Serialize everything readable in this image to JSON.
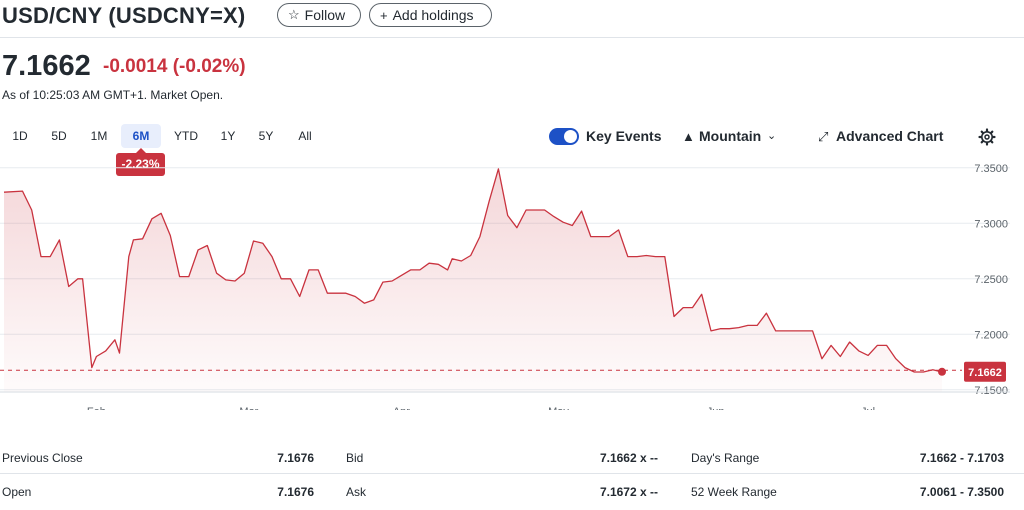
{
  "header": {
    "title": "USD/CNY (USDCNY=X)",
    "follow_label": "Follow",
    "add_holdings_label": "Add holdings"
  },
  "quote": {
    "price": "7.1662",
    "change": "-0.0014",
    "change_pct": "(-0.02%)",
    "as_of": "As of 10:25:03 AM GMT+1. Market Open.",
    "change_color": "#c9333f"
  },
  "ranges": {
    "items": [
      "1D",
      "5D",
      "1M",
      "6M",
      "YTD",
      "1Y",
      "5Y",
      "All"
    ],
    "active": "6M",
    "active_change": "-2.23%"
  },
  "controls": {
    "key_events_label": "Key Events",
    "key_events_on": true,
    "chart_type_label": "Mountain",
    "advanced_chart_label": "Advanced Chart",
    "chart_type_icon": "mountain-icon",
    "advanced_icon": "expand-icon",
    "settings_icon": "gear-icon"
  },
  "chart_data": {
    "type": "area",
    "line_color": "#c9333f",
    "ylim": [
      7.148,
      7.357
    ],
    "yticks": [
      "7.3500",
      "7.3000",
      "7.2500",
      "7.2000",
      "7.1500"
    ],
    "xlabels": [
      {
        "label": "Feb",
        "day": 20
      },
      {
        "label": "Mar",
        "day": 53
      },
      {
        "label": "Apr",
        "day": 86
      },
      {
        "label": "May",
        "day": 120
      },
      {
        "label": "Jun",
        "day": 154
      },
      {
        "label": "Jul",
        "day": 187
      }
    ],
    "previous_close": 7.1676,
    "last_value": 7.1662,
    "last_label": "7.1662",
    "x": [
      0,
      4,
      6,
      8,
      10,
      12,
      14,
      16,
      17,
      19,
      20,
      22,
      24,
      25,
      27,
      28,
      30,
      32,
      34,
      36,
      38,
      40,
      42,
      44,
      46,
      48,
      50,
      52,
      54,
      56,
      58,
      60,
      62,
      64,
      66,
      68,
      70,
      72,
      74,
      76,
      78,
      80,
      82,
      84,
      86,
      88,
      90,
      92,
      94,
      96,
      97,
      99,
      101,
      103,
      105,
      107,
      109,
      111,
      113,
      115,
      117,
      119,
      121,
      123,
      125,
      127,
      129,
      131,
      133,
      135,
      137,
      139,
      141,
      143,
      145,
      147,
      149,
      151,
      153,
      155,
      157,
      159,
      161,
      163,
      165,
      167,
      169,
      171,
      173,
      175,
      177,
      179,
      181,
      183,
      185,
      187,
      189,
      191,
      193,
      195,
      197,
      199,
      201,
      203
    ],
    "y": [
      7.328,
      7.329,
      7.312,
      7.27,
      7.27,
      7.285,
      7.243,
      7.25,
      7.25,
      7.17,
      7.18,
      7.185,
      7.195,
      7.183,
      7.27,
      7.285,
      7.286,
      7.304,
      7.309,
      7.289,
      7.252,
      7.252,
      7.276,
      7.28,
      7.255,
      7.249,
      7.248,
      7.255,
      7.284,
      7.282,
      7.27,
      7.25,
      7.25,
      7.234,
      7.258,
      7.258,
      7.237,
      7.237,
      7.237,
      7.234,
      7.228,
      7.231,
      7.247,
      7.248,
      7.253,
      7.258,
      7.258,
      7.264,
      7.263,
      7.258,
      7.268,
      7.266,
      7.271,
      7.288,
      7.32,
      7.349,
      7.307,
      7.296,
      7.312,
      7.312,
      7.312,
      7.306,
      7.301,
      7.298,
      7.311,
      7.288,
      7.288,
      7.288,
      7.294,
      7.27,
      7.27,
      7.271,
      7.27,
      7.27,
      7.216,
      7.224,
      7.224,
      7.236,
      7.203,
      7.205,
      7.205,
      7.206,
      7.208,
      7.208,
      7.219,
      7.203,
      7.203,
      7.203,
      7.203,
      7.203,
      7.178,
      7.19,
      7.18,
      7.193,
      7.185,
      7.181,
      7.19,
      7.19,
      7.178,
      7.17,
      7.166,
      7.166,
      7.168,
      7.166
    ]
  },
  "stats": [
    [
      {
        "label": "Previous Close",
        "value": "7.1676"
      },
      {
        "label": "Bid",
        "value": "7.1662 x --"
      },
      {
        "label": "Day's Range",
        "value": "7.1662 - 7.1703"
      }
    ],
    [
      {
        "label": "Open",
        "value": "7.1676"
      },
      {
        "label": "Ask",
        "value": "7.1672 x --"
      },
      {
        "label": "52 Week Range",
        "value": "7.0061 - 7.3500"
      }
    ]
  ]
}
